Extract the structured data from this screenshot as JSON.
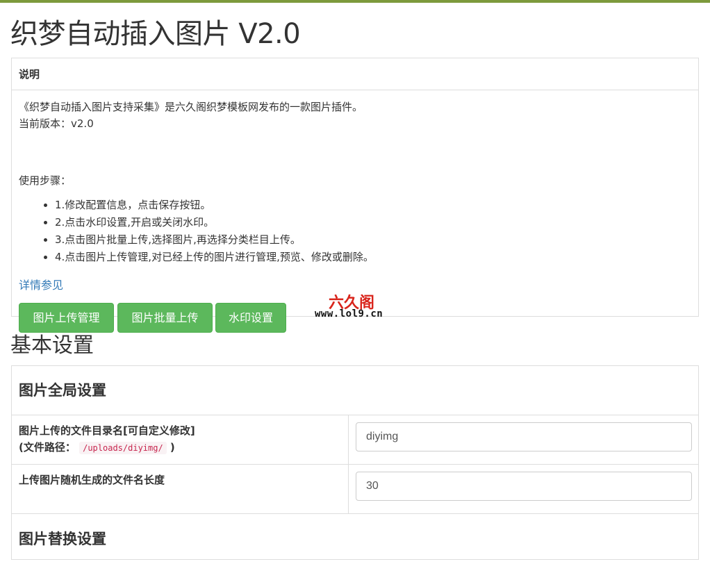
{
  "page": {
    "title": "织梦自动插入图片 V2.0"
  },
  "intro_panel": {
    "heading": "说明",
    "description": "《织梦自动插入图片支持采集》是六久阁织梦模板网发布的一款图片插件。",
    "version": "当前版本：v2.0",
    "steps_label": "使用步骤：",
    "steps": [
      "1.修改配置信息，点击保存按钮。",
      "2.点击水印设置,开启或关闭水印。",
      "3.点击图片批量上传,选择图片,再选择分类栏目上传。",
      "4.点击图片上传管理,对已经上传的图片进行管理,预览、修改或删除。"
    ],
    "more_link": "详情参见",
    "buttons": {
      "manage": "图片上传管理",
      "batch_upload": "图片批量上传",
      "watermark": "水印设置"
    },
    "logo": {
      "name": "六久阁",
      "url": "www.lol9.cn"
    }
  },
  "basic_settings": {
    "title": "基本设置",
    "global_section": "图片全局设置",
    "rows": [
      {
        "label": "图片上传的文件目录名[可自定义修改]",
        "sub_prefix": "(文件路径：",
        "path": "/uploads/diyimg/",
        "sub_suffix": ")",
        "value": "diyimg"
      },
      {
        "label": "上传图片随机生成的文件名长度",
        "value": "30"
      }
    ],
    "replace_section": "图片替换设置"
  },
  "colors": {
    "accent_bar": "#7d9a3c",
    "button_green": "#5cb85c",
    "link_blue": "#337ab7",
    "logo_red": "#d9251c",
    "code_red": "#c7254e"
  }
}
